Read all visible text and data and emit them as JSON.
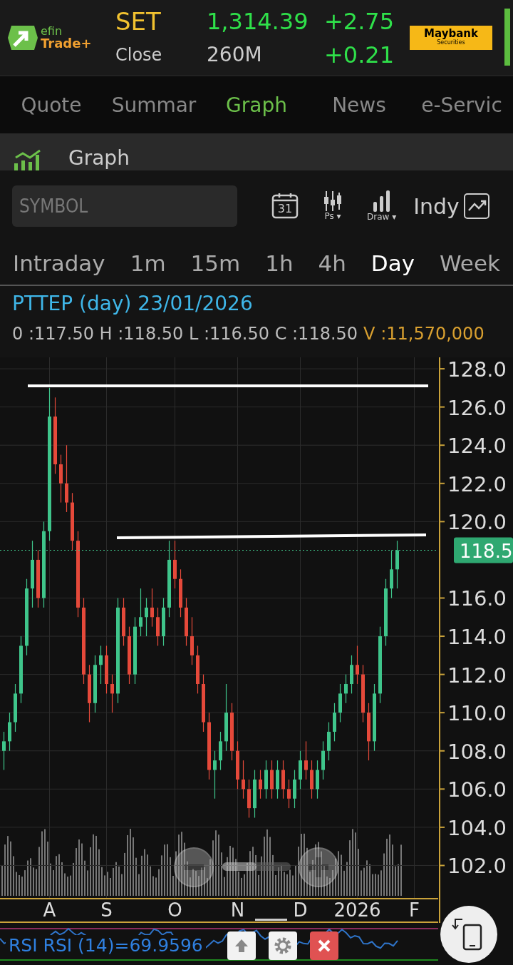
{
  "header": {
    "logo_line_1": "efin",
    "logo_line_2": "Trade+",
    "index_name": "SET",
    "index_value": "1,314.39",
    "index_change": "+2.75",
    "session": "Close",
    "turnover": "260M",
    "percent_change": "+0.21",
    "broker_name": "Maybank",
    "broker_subtitle": "Securities"
  },
  "tabs": [
    {
      "label": "Quote",
      "selected": false
    },
    {
      "label": "Summar",
      "selected": false
    },
    {
      "label": "Graph",
      "selected": true
    },
    {
      "label": "News",
      "selected": false
    },
    {
      "label": "e-Servic",
      "selected": false
    }
  ],
  "section": {
    "title": "Graph"
  },
  "toolbar": {
    "symbol_placeholder": "SYMBOL",
    "calendar_day": "31",
    "price_style_label": "Ps ▾",
    "draw_label": "Draw ▾",
    "indicator_label": "Indy"
  },
  "timeframes": [
    {
      "label": "Intraday",
      "selected": false
    },
    {
      "label": "1m",
      "selected": false
    },
    {
      "label": "15m",
      "selected": false
    },
    {
      "label": "1h",
      "selected": false
    },
    {
      "label": "4h",
      "selected": false
    },
    {
      "label": "Day",
      "selected": true
    },
    {
      "label": "Week",
      "selected": false
    }
  ],
  "quote": {
    "title": "PTTEP (day) 23/01/2026",
    "ohlc": "0 :117.50 H :118.50 L :116.50 C :118.50",
    "volume": "V :11,570,000"
  },
  "chart": {
    "last_price": "118.5",
    "zoom": {
      "level": 0.5
    },
    "chart_data": {
      "type": "candlestick",
      "categories": [
        null,
        null,
        null,
        null,
        null,
        null,
        null,
        null,
        "A",
        null,
        null,
        null,
        null,
        null,
        null,
        null,
        null,
        null,
        "S",
        null,
        null,
        null,
        null,
        null,
        null,
        null,
        null,
        null,
        null,
        null,
        "O",
        null,
        null,
        null,
        null,
        null,
        null,
        null,
        null,
        null,
        null,
        "N",
        null,
        null,
        null,
        null,
        null,
        null,
        null,
        null,
        null,
        null,
        "D",
        null,
        null,
        null,
        null,
        null,
        null,
        null,
        null,
        null,
        "2026",
        null,
        null,
        null,
        null,
        null,
        null,
        null,
        null,
        null,
        "F"
      ],
      "ohlc": [
        [
          108,
          109,
          107,
          108.5
        ],
        [
          108.5,
          110,
          108,
          109.5
        ],
        [
          109.5,
          111.5,
          109,
          111
        ],
        [
          111,
          114,
          110.5,
          113.5
        ],
        [
          113.5,
          117,
          113,
          116.5
        ],
        [
          116.5,
          119,
          115.5,
          118
        ],
        [
          118,
          118.5,
          115.5,
          116
        ],
        [
          116,
          120,
          115.5,
          119.5
        ],
        [
          119.5,
          127,
          119,
          125.5
        ],
        [
          125.5,
          126.5,
          122.5,
          123
        ],
        [
          123,
          123.5,
          121,
          122
        ],
        [
          122,
          124,
          120.5,
          121
        ],
        [
          121,
          121.5,
          118.5,
          119
        ],
        [
          119,
          119.5,
          115,
          115.5
        ],
        [
          115.5,
          116,
          111.5,
          112
        ],
        [
          112,
          112.5,
          109.5,
          110.5
        ],
        [
          110.5,
          113,
          110,
          112.5
        ],
        [
          112.5,
          113.5,
          111.5,
          113
        ],
        [
          113,
          113.5,
          111,
          111.5
        ],
        [
          111.5,
          112,
          110,
          111
        ],
        [
          111,
          116,
          110.5,
          115.5
        ],
        [
          115.5,
          116,
          113.5,
          114
        ],
        [
          114,
          114.5,
          111.5,
          112
        ],
        [
          112,
          115,
          111.5,
          114.5
        ],
        [
          114.5,
          116.5,
          114,
          115
        ],
        [
          115,
          116,
          114,
          115.5
        ],
        [
          115.5,
          116.5,
          114.5,
          115
        ],
        [
          115,
          115.5,
          113.5,
          114
        ],
        [
          114,
          116,
          113.5,
          115.5
        ],
        [
          115.5,
          119,
          115,
          118
        ],
        [
          118,
          119,
          116.5,
          117
        ],
        [
          117,
          117.5,
          115,
          115.5
        ],
        [
          115.5,
          116,
          113.5,
          114
        ],
        [
          114,
          115,
          112.5,
          113
        ],
        [
          113,
          113.5,
          111,
          111.5
        ],
        [
          111.5,
          112,
          109,
          109.5
        ],
        [
          109.5,
          110,
          106.5,
          107
        ],
        [
          107,
          108,
          105.5,
          107.5
        ],
        [
          107.5,
          109,
          107,
          108.5
        ],
        [
          108.5,
          111.5,
          108,
          110
        ],
        [
          110,
          110.5,
          107.5,
          108
        ],
        [
          108,
          108.5,
          106,
          106.5
        ],
        [
          106.5,
          107.5,
          105.5,
          106
        ],
        [
          106,
          106.5,
          104.5,
          105
        ],
        [
          105,
          107,
          104.5,
          106.5
        ],
        [
          106.5,
          107,
          105.5,
          106
        ],
        [
          106,
          107.5,
          105.5,
          107
        ],
        [
          107,
          107.5,
          105.5,
          106
        ],
        [
          106,
          107.5,
          105.5,
          107
        ],
        [
          107,
          107.5,
          105.5,
          106
        ],
        [
          106,
          106.5,
          105,
          105.5
        ],
        [
          105.5,
          107,
          105,
          106.5
        ],
        [
          106.5,
          108,
          106,
          107.5
        ],
        [
          107.5,
          108.5,
          106.5,
          107
        ],
        [
          107,
          107.5,
          105.5,
          106
        ],
        [
          106,
          107.5,
          105.5,
          107
        ],
        [
          107,
          108.5,
          106.5,
          108
        ],
        [
          108,
          109.5,
          107.5,
          109
        ],
        [
          109,
          110.5,
          108.5,
          110
        ],
        [
          110,
          111.5,
          109.5,
          111
        ],
        [
          111,
          112,
          110.5,
          111.5
        ],
        [
          111.5,
          113,
          111,
          112.5
        ],
        [
          112.5,
          113.5,
          111.5,
          112
        ],
        [
          112,
          112.5,
          109.5,
          110
        ],
        [
          110,
          110.5,
          107.5,
          108.5
        ],
        [
          108.5,
          111.5,
          108,
          111
        ],
        [
          111,
          114.5,
          110.5,
          114
        ],
        [
          114,
          117,
          113.5,
          116.5
        ],
        [
          116.5,
          118.5,
          116,
          117.5
        ],
        [
          117.5,
          119,
          116.5,
          118.5
        ],
        null,
        null,
        null
      ],
      "ylim": [
        100.3,
        128.6
      ],
      "grid": true,
      "ref_lines": [
        {
          "axis": "y",
          "value": 118.5
        }
      ],
      "yticks": [
        {
          "value": 128,
          "label": "128.0"
        },
        {
          "value": 126,
          "label": "126.0"
        },
        {
          "value": 124,
          "label": "124.0"
        },
        {
          "value": 122,
          "label": "122.0"
        },
        {
          "value": 120,
          "label": "120.0"
        },
        {
          "value": 116,
          "label": "116.0"
        },
        {
          "value": 114,
          "label": "114.0"
        },
        {
          "value": 112,
          "label": "112.0"
        },
        {
          "value": 110,
          "label": "110.0"
        },
        {
          "value": 108,
          "label": "108.0"
        },
        {
          "value": 106,
          "label": "106.0"
        },
        {
          "value": 104,
          "label": "104.0"
        },
        {
          "value": 102,
          "label": "102.0"
        }
      ]
    }
  },
  "rsi": {
    "label": "RSI RSI (14)=69.9596"
  }
}
